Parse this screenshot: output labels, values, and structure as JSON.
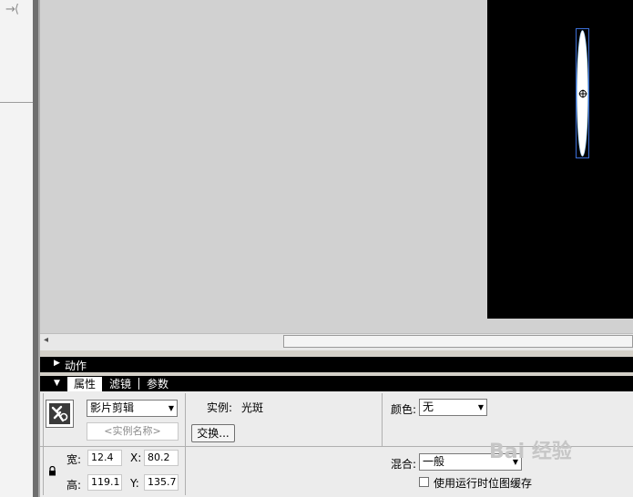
{
  "panels": {
    "actions_label": "动作"
  },
  "property_tabs": [
    {
      "label": "属性"
    },
    {
      "label": "滤镜"
    },
    {
      "label": "参数"
    }
  ],
  "properties": {
    "symbol_type": "影片剪辑",
    "instance_name_placeholder": "<实例名称>",
    "instance_label": "实例:",
    "instance_value": "光斑",
    "swap_label": "交换...",
    "color_label": "颜色:",
    "color_value": "无",
    "blend_label": "混合:",
    "blend_value": "一般",
    "bitmap_cache_label": "使用运行时位图缓存",
    "bitmap_cache_checked": false,
    "width_label": "宽:",
    "width_value": "12.4",
    "height_label": "高:",
    "height_value": "119.1",
    "x_label": "X:",
    "x_value": "80.2",
    "y_label": "Y:",
    "y_value": "135.7"
  },
  "watermark": {
    "text": "Bai 经验"
  },
  "icons": {
    "collapse": "collapse-arrow-icon",
    "lock": "lock-icon",
    "symbol": "movie-clip-icon",
    "registration": "registration-point-icon"
  },
  "colors": {
    "selection": "#3b6fd8",
    "stage": "#d1d1d1",
    "clip_fill": "#ffffff"
  }
}
